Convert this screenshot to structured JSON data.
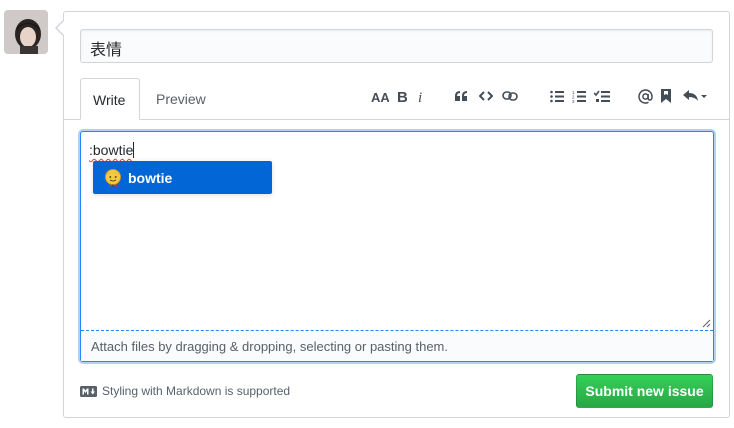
{
  "issue": {
    "title_value": "表情"
  },
  "tabs": [
    {
      "label": "Write"
    },
    {
      "label": "Preview"
    }
  ],
  "toolbar": {
    "icons": [
      "text-size-icon",
      "bold-icon",
      "italic-icon",
      "quote-icon",
      "code-icon",
      "link-icon",
      "unordered-list-icon",
      "ordered-list-icon",
      "task-list-icon",
      "mention-icon",
      "bookmark-icon",
      "reply-icon"
    ]
  },
  "editor": {
    "value": ":bowtie",
    "attach_text": "Attach files by dragging & dropping, selecting or pasting them."
  },
  "suggestions": [
    {
      "emoji": "bowtie",
      "label": "bowtie"
    }
  ],
  "footer": {
    "markdown_note": "Styling with Markdown is supported",
    "submit_label": "Submit new issue"
  },
  "colors": {
    "accent": "#0366d6",
    "submit": "#2cbe4e",
    "focus_border": "#2188ff"
  }
}
